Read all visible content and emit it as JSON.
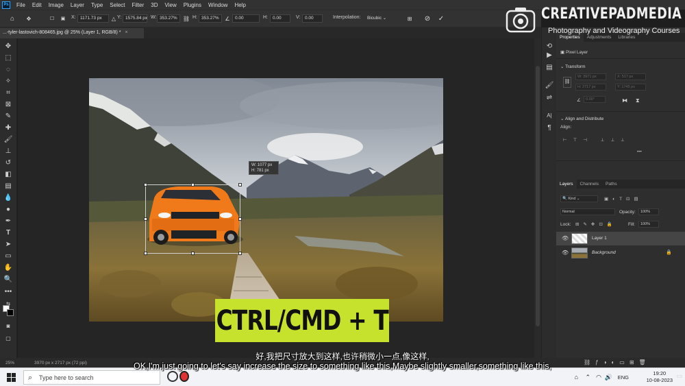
{
  "menubar": {
    "logo": "Ps",
    "items": [
      "File",
      "Edit",
      "Image",
      "Layer",
      "Type",
      "Select",
      "Filter",
      "3D",
      "View",
      "Plugins",
      "Window",
      "Help"
    ]
  },
  "options": {
    "x_label": "X:",
    "x_value": "1171.73 px",
    "y_label": "Y:",
    "y_value": "1575.84 px",
    "w_label": "W:",
    "w_value": "353.27%",
    "h_label": "H:",
    "h_value": "353.27%",
    "angle_value": "0.00",
    "hskew_label": "H:",
    "hskew_value": "0.00",
    "vskew_label": "V:",
    "vskew_value": "0.00",
    "interp_label": "Interpolation:",
    "interp_value": "Bicubic"
  },
  "doc_tab": {
    "title": "...-tyler-lastovich-808465.jpg @ 25% (Layer 1, RGB/8) *",
    "close": "×"
  },
  "readout": {
    "w": "W: 1077 px",
    "h": "H:   781 px"
  },
  "properties": {
    "tabs": [
      "Properties",
      "Adjustments",
      "Libraries"
    ],
    "layer_type": "Pixel Layer",
    "transform_title": "Transform",
    "w_field": "W: 3971 px",
    "x_field": "X: 517 px",
    "h_field": "H: 2717 px",
    "y_field": "Y: 1745 px",
    "angle_field": "0.00°",
    "align_title": "Align and Distribute",
    "align_label": "Align:",
    "more": "•••"
  },
  "layers": {
    "tabs": [
      "Layers",
      "Channels",
      "Paths"
    ],
    "filter": "Kind",
    "blend_mode": "Normal",
    "opacity_label": "Opacity:",
    "opacity_value": "100%",
    "lock_label": "Lock:",
    "fill_label": "Fill:",
    "fill_value": "100%",
    "items": [
      {
        "name": "Layer 1"
      },
      {
        "name": "Background"
      }
    ]
  },
  "watermark": {
    "title": "CREATIVEPADMEDIA",
    "subtitle": "Photography and Videography Courses"
  },
  "status": {
    "zoom": "25%",
    "doc_info": "3970 px x 2717 px (72 ppi)"
  },
  "hotkey": "CTRL/CMD + T",
  "subtitles": {
    "zh": "好,我把尺寸放大到这样,也许稍微小一点,像这样,",
    "en": "OK,I'm just going to let's say increase the size to something like this,Maybe slightly smaller,something like this,"
  },
  "taskbar": {
    "search_placeholder": "Type here to search",
    "lang": "ENG",
    "time": "19:20",
    "date": "10-08-2023"
  },
  "colors": {
    "accent_blue": "#31a8ff",
    "hotkey_bg": "#c6e22d",
    "car_orange": "#f07a1a"
  }
}
